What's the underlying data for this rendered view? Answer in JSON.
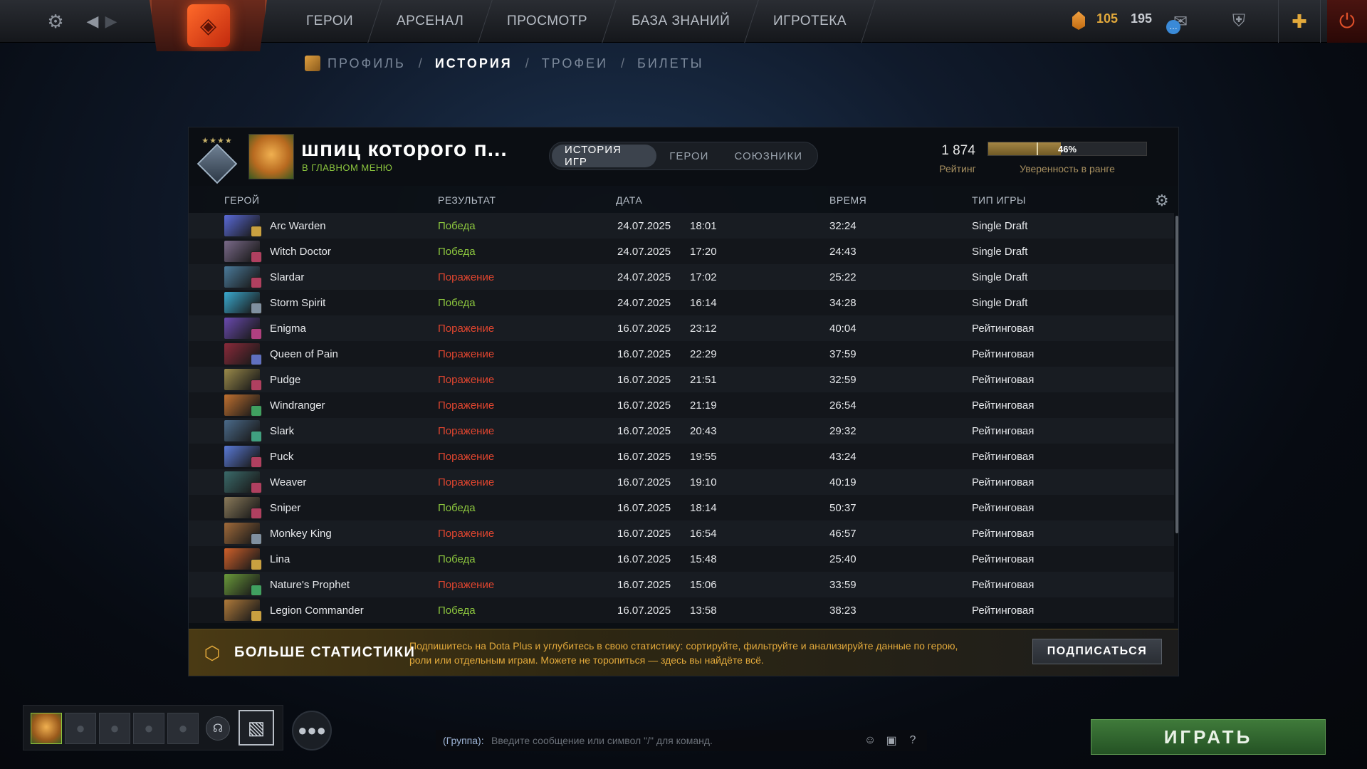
{
  "topbar": {
    "nav": [
      "ГЕРОИ",
      "АРСЕНАЛ",
      "ПРОСМОТР",
      "БАЗА ЗНАНИЙ",
      "ИГРОТЕКА"
    ],
    "shards": "105",
    "coins": "195",
    "icons": {
      "settings": "gear-icon",
      "back": "arrow-left-icon",
      "forward": "arrow-right-icon",
      "mail": "mail-icon",
      "armory": "armory-icon",
      "plus": "dota-plus-icon",
      "power": "power-icon"
    }
  },
  "subnav": {
    "items": [
      "ПРОФИЛЬ",
      "ИСТОРИЯ",
      "ТРОФЕИ",
      "БИЛЕТЫ"
    ],
    "active": "ИСТОРИЯ",
    "separator": "/"
  },
  "profile": {
    "name": "шпиц которого п...",
    "status": "В ГЛАВНОМ МЕНЮ",
    "tabs": [
      "ИСТОРИЯ ИГР",
      "ГЕРОИ",
      "СОЮЗНИКИ"
    ],
    "active_tab": "ИСТОРИЯ ИГР",
    "rating": "1 874",
    "rating_label": "Рейтинг",
    "confidence": 0.46,
    "confidence_text": "46%",
    "confidence_label": "Уверенность в ранге"
  },
  "table": {
    "headers": {
      "hero": "ГЕРОЙ",
      "result": "РЕЗУЛЬТАТ",
      "date": "ДАТА",
      "duration": "ВРЕМЯ",
      "mode": "ТИП ИГРЫ"
    },
    "rows": [
      {
        "hero": "Arc Warden",
        "result": "Победа",
        "win": true,
        "date": "24.07.2025",
        "time": "18:01",
        "duration": "32:24",
        "mode": "Single Draft",
        "color": "#5a6ad8",
        "badge": "#c9a040"
      },
      {
        "hero": "Witch Doctor",
        "result": "Победа",
        "win": true,
        "date": "24.07.2025",
        "time": "17:20",
        "duration": "24:43",
        "mode": "Single Draft",
        "color": "#7a6a8a",
        "badge": "#b04060"
      },
      {
        "hero": "Slardar",
        "result": "Поражение",
        "win": false,
        "date": "24.07.2025",
        "time": "17:02",
        "duration": "25:22",
        "mode": "Single Draft",
        "color": "#4a7a9a",
        "badge": "#b04060"
      },
      {
        "hero": "Storm Spirit",
        "result": "Победа",
        "win": true,
        "date": "24.07.2025",
        "time": "16:14",
        "duration": "34:28",
        "mode": "Single Draft",
        "color": "#3aaad0",
        "badge": "#8090a0"
      },
      {
        "hero": "Enigma",
        "result": "Поражение",
        "win": false,
        "date": "16.07.2025",
        "time": "23:12",
        "duration": "40:04",
        "mode": "Рейтинговая",
        "color": "#6a4ab0",
        "badge": "#b04080"
      },
      {
        "hero": "Queen of Pain",
        "result": "Поражение",
        "win": false,
        "date": "16.07.2025",
        "time": "22:29",
        "duration": "37:59",
        "mode": "Рейтинговая",
        "color": "#8a2a3a",
        "badge": "#6070c0"
      },
      {
        "hero": "Pudge",
        "result": "Поражение",
        "win": false,
        "date": "16.07.2025",
        "time": "21:51",
        "duration": "32:59",
        "mode": "Рейтинговая",
        "color": "#9a8a4a",
        "badge": "#b04060"
      },
      {
        "hero": "Windranger",
        "result": "Поражение",
        "win": false,
        "date": "16.07.2025",
        "time": "21:19",
        "duration": "26:54",
        "mode": "Рейтинговая",
        "color": "#c07030",
        "badge": "#40a060"
      },
      {
        "hero": "Slark",
        "result": "Поражение",
        "win": false,
        "date": "16.07.2025",
        "time": "20:43",
        "duration": "29:32",
        "mode": "Рейтинговая",
        "color": "#4a6a8a",
        "badge": "#40a080"
      },
      {
        "hero": "Puck",
        "result": "Поражение",
        "win": false,
        "date": "16.07.2025",
        "time": "19:55",
        "duration": "43:24",
        "mode": "Рейтинговая",
        "color": "#5a7ad8",
        "badge": "#b04060"
      },
      {
        "hero": "Weaver",
        "result": "Поражение",
        "win": false,
        "date": "16.07.2025",
        "time": "19:10",
        "duration": "40:19",
        "mode": "Рейтинговая",
        "color": "#3a6a6a",
        "badge": "#b04060"
      },
      {
        "hero": "Sniper",
        "result": "Победа",
        "win": true,
        "date": "16.07.2025",
        "time": "18:14",
        "duration": "50:37",
        "mode": "Рейтинговая",
        "color": "#8a7a5a",
        "badge": "#b04060"
      },
      {
        "hero": "Monkey King",
        "result": "Поражение",
        "win": false,
        "date": "16.07.2025",
        "time": "16:54",
        "duration": "46:57",
        "mode": "Рейтинговая",
        "color": "#a06a3a",
        "badge": "#8090a0"
      },
      {
        "hero": "Lina",
        "result": "Победа",
        "win": true,
        "date": "16.07.2025",
        "time": "15:48",
        "duration": "25:40",
        "mode": "Рейтинговая",
        "color": "#d0602a",
        "badge": "#c9a040"
      },
      {
        "hero": "Nature's Prophet",
        "result": "Поражение",
        "win": false,
        "date": "16.07.2025",
        "time": "15:06",
        "duration": "33:59",
        "mode": "Рейтинговая",
        "color": "#6a9a3a",
        "badge": "#40a060"
      },
      {
        "hero": "Legion Commander",
        "result": "Победа",
        "win": true,
        "date": "16.07.2025",
        "time": "13:58",
        "duration": "38:23",
        "mode": "Рейтинговая",
        "color": "#b07a3a",
        "badge": "#c9a040"
      }
    ]
  },
  "promo": {
    "title": "БОЛЬШЕ СТАТИСТИКИ",
    "text": "Подпишитесь на Dota Plus и углубитесь в свою статистику: сортируйте, фильтруйте и анализируйте данные по герою, роли или отдельным играм. Можете не торопиться — здесь вы найдёте всё.",
    "button": "ПОДПИСАТЬСЯ"
  },
  "chat": {
    "label": "(Группа):",
    "placeholder": "Введите сообщение или символ \"/\" для команд."
  },
  "play_button": "ИГРАТЬ"
}
